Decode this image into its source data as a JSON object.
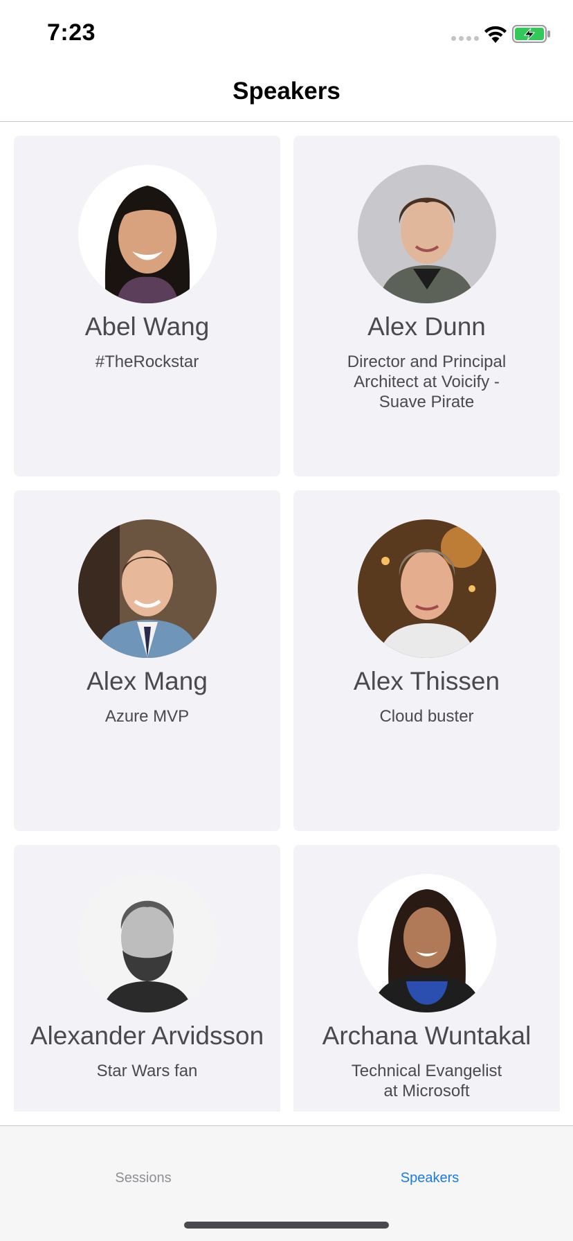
{
  "status_bar": {
    "time": "7:23",
    "icons": [
      "cellular-dots-icon",
      "wifi-icon",
      "battery-charging-icon"
    ],
    "battery_color": "#34c759"
  },
  "header": {
    "title": "Speakers"
  },
  "speakers": [
    {
      "name": "Abel Wang",
      "title": "#TheRockstar"
    },
    {
      "name": "Alex Dunn",
      "title": "Director and Principal Architect at Voicify - Suave Pirate"
    },
    {
      "name": "Alex Mang",
      "title": "Azure MVP"
    },
    {
      "name": "Alex Thissen",
      "title": "Cloud buster"
    },
    {
      "name": "Alexander Arvidsson",
      "title": "Star Wars fan"
    },
    {
      "name": "Archana Wuntakal",
      "title": "Technical Evangelist at Microsoft"
    }
  ],
  "tab_bar": {
    "tabs": [
      {
        "label": "Sessions",
        "selected": false
      },
      {
        "label": "Speakers",
        "selected": true
      }
    ],
    "selected_color": "#1a7be6",
    "unselected_color": "#8e8e93"
  }
}
